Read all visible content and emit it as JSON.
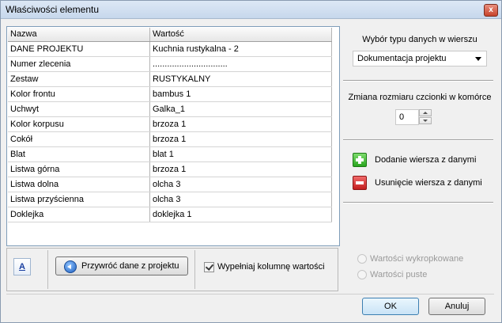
{
  "window": {
    "title": "Właściwości elementu",
    "close_glyph": "x"
  },
  "table": {
    "columns": [
      "Nazwa",
      "Wartość"
    ],
    "rows": [
      [
        "DANE PROJEKTU",
        "Kuchnia rustykalna - 2"
      ],
      [
        "Numer zlecenia",
        "..............................."
      ],
      [
        "Zestaw",
        "RUSTYKALNY"
      ],
      [
        "Kolor frontu",
        "bambus 1"
      ],
      [
        "Uchwyt",
        "Galka_1"
      ],
      [
        "Kolor korpusu",
        "brzoza 1"
      ],
      [
        "Cokół",
        "brzoza 1"
      ],
      [
        "Blat",
        "blat 1"
      ],
      [
        "Listwa górna",
        "brzoza 1"
      ],
      [
        "Listwa dolna",
        "olcha 3"
      ],
      [
        "Listwa przyścienna",
        "olcha 3"
      ],
      [
        "Doklejka",
        "doklejka 1"
      ]
    ]
  },
  "right_panel": {
    "type_label": "Wybór typu danych w wierszu",
    "type_value": "Dokumentacja projektu",
    "font_label": "Zmiana rozmiaru czcionki w komórce",
    "font_value": "0",
    "add_row": "Dodanie wiersza z danymi",
    "remove_row": "Usunięcie wiersza z danymi"
  },
  "bottom": {
    "font_button": "A",
    "restore_button": "Przywróć dane z projektu",
    "fill_checkbox": "Wypełniaj kolumnę wartości",
    "fill_checked": true,
    "radio_dotted": "Wartości wykropkowane",
    "radio_empty": "Wartości puste",
    "ok": "OK",
    "cancel": "Anuluj"
  }
}
